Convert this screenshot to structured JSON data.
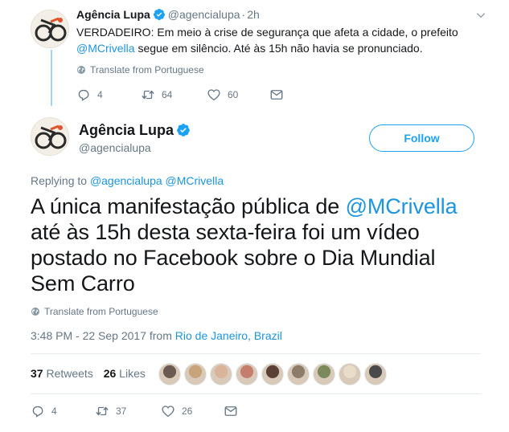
{
  "parent_tweet": {
    "author_name": "Agência Lupa",
    "handle": "@agencialupa",
    "separator": "·",
    "time": "2h",
    "text_before_mention": "VERDADEIRO: Em meio à crise de segurança que afeta a cidade, o prefeito ",
    "mention": "@MCrivella",
    "text_after_mention": " segue em silêncio. Até às 15h não havia se pronunciado.",
    "translate_label": "Translate from Portuguese",
    "actions": {
      "replies": "4",
      "retweets": "64",
      "likes": "60"
    }
  },
  "main_tweet": {
    "author_name": "Agência Lupa",
    "handle": "@agencialupa",
    "follow_label": "Follow",
    "replying_prefix": "Replying to ",
    "replying_mentions": "@agencialupa @MCrivella",
    "text_before_mention": "A única manifestação pública de ",
    "mention": "@MCrivella",
    "text_after_mention": " até às 15h desta sexta-feira foi um vídeo postado no Facebook sobre o Dia Mundial Sem Carro",
    "translate_label": "Translate from Portuguese",
    "timestamp": "3:48 PM - 22 Sep 2017 from ",
    "location": "Rio de Janeiro, Brazil",
    "stats": {
      "retweets_count": "37",
      "retweets_label": " Retweets",
      "likes_count": "26",
      "likes_label": " Likes"
    },
    "actions": {
      "replies": "4",
      "retweets": "37",
      "likes": "26"
    }
  },
  "colors": {
    "link": "#1b95e0",
    "brand_blue": "#1da1f2",
    "muted": "#657786",
    "thread_line": "#9fd6f5"
  },
  "icons": [
    "avatar-logo",
    "verified-badge",
    "caret-down-icon",
    "globe-icon",
    "reply-icon",
    "retweet-icon",
    "like-icon",
    "dm-icon"
  ],
  "liker_avatar_colors": [
    "#6b5a52",
    "#c9a37a",
    "#d9b39a",
    "#c77d6e",
    "#5a4036",
    "#8e7c6a",
    "#7a8a5c",
    "#e9dcc9",
    "#4a4a4a"
  ]
}
